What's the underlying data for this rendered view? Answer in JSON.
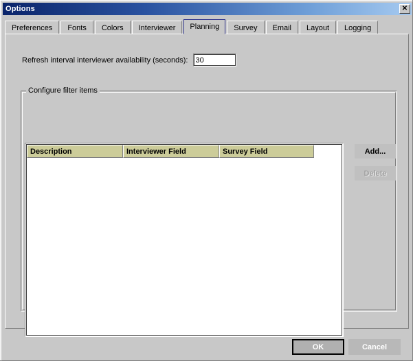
{
  "window": {
    "title": "Options",
    "close_icon": "close-icon",
    "close_glyph": "✕"
  },
  "tabs": [
    {
      "label": "Preferences",
      "selected": false
    },
    {
      "label": "Fonts",
      "selected": false
    },
    {
      "label": "Colors",
      "selected": false
    },
    {
      "label": "Interviewer",
      "selected": false
    },
    {
      "label": "Planning",
      "selected": true
    },
    {
      "label": "Survey",
      "selected": false
    },
    {
      "label": "Email",
      "selected": false
    },
    {
      "label": "Layout",
      "selected": false
    },
    {
      "label": "Logging",
      "selected": false
    }
  ],
  "planning": {
    "refresh": {
      "label": "Refresh interval interviewer availability (seconds):",
      "value": "30",
      "placeholder": ""
    },
    "groupbox": {
      "label": "Configure filter items"
    },
    "filter_table": {
      "columns": [
        "Description",
        "Interviewer Field",
        "Survey Field"
      ],
      "rows": []
    },
    "side_buttons": {
      "add_label": "Add...",
      "delete_label": "Delete"
    }
  },
  "footer": {
    "ok_label": "OK",
    "cancel_label": "Cancel"
  },
  "colors": {
    "dialog_face": "#c8c8c8",
    "titlebar_start": "#0a246a",
    "titlebar_end": "#a6caf0",
    "tab_selected_border": "#30348c",
    "table_header": "#cccc99",
    "listview_bg": "#ffffff",
    "disabled_text": "#a0a0a0"
  }
}
